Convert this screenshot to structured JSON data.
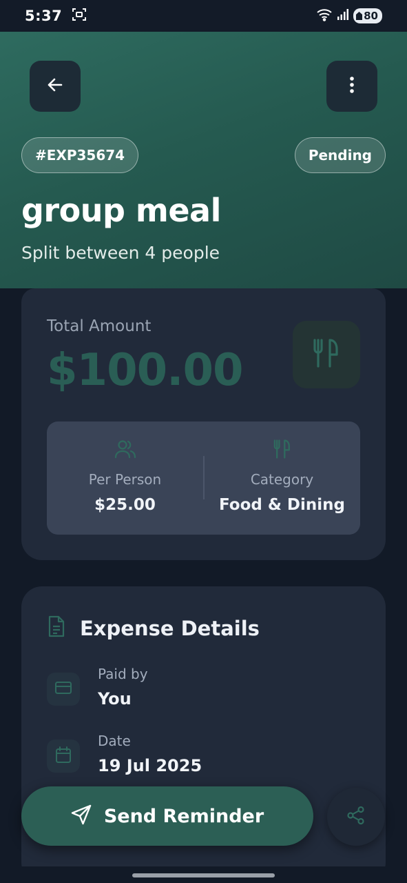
{
  "status_bar": {
    "time": "5:37",
    "battery": "80"
  },
  "header": {
    "expense_id": "#EXP35674",
    "status": "Pending",
    "title": "group meal",
    "subtitle": "Split between 4 people"
  },
  "amount_card": {
    "label": "Total Amount",
    "amount": "$100.00",
    "category_icon": "utensils-icon",
    "per_person_label": "Per Person",
    "per_person_value": "$25.00",
    "category_label": "Category",
    "category_value": "Food & Dining"
  },
  "details_card": {
    "title": "Expense Details",
    "rows": [
      {
        "icon": "credit-card-icon",
        "label": "Paid by",
        "value": "You"
      },
      {
        "icon": "calendar-icon",
        "label": "Date",
        "value": "19 Jul 2025"
      }
    ]
  },
  "actions": {
    "send_reminder_label": "Send Reminder",
    "share_icon": "share-icon"
  },
  "colors": {
    "background": "#121a27",
    "card": "#212a3a",
    "accent": "#2c5f55",
    "header_gradient_start": "#2e6b5f",
    "header_gradient_end": "#1f4a44"
  }
}
